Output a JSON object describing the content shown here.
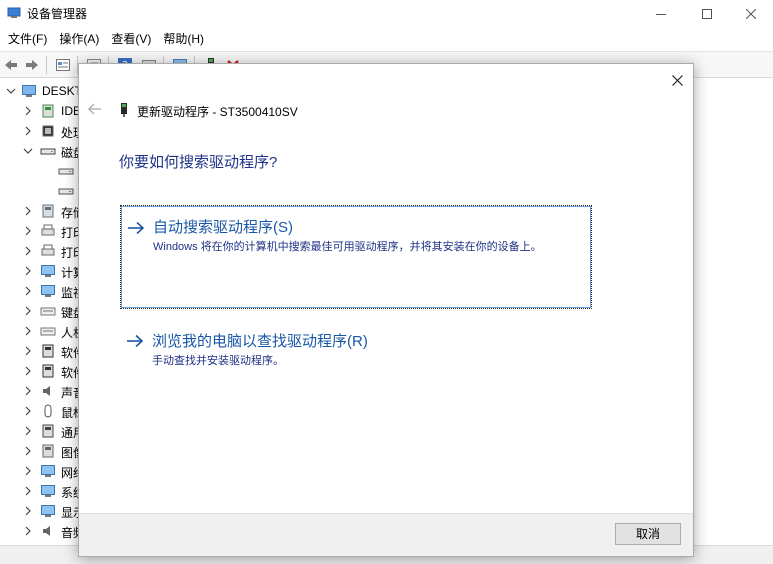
{
  "window": {
    "title": "设备管理器",
    "icon": "device-manager-icon"
  },
  "menu": [
    "文件(F)",
    "操作(A)",
    "查看(V)",
    "帮助(H)"
  ],
  "toolbar": {
    "icons": [
      "back-icon",
      "forward-icon",
      "properties-icon",
      "show-hidden-icon",
      "help-icon",
      "view-icon",
      "monitor-icon",
      "update-driver-icon",
      "uninstall-icon"
    ],
    "uninstall_color": "#d01a1a"
  },
  "tree": {
    "root": "DESKT",
    "items": [
      {
        "label": "IDE",
        "icon": "ide-controller-icon",
        "expanded": false
      },
      {
        "label": "处理",
        "icon": "processor-icon",
        "expanded": false
      },
      {
        "label": "磁盘",
        "icon": "disk-drive-icon",
        "expanded": true
      },
      {
        "label": "",
        "icon": "disk-icon",
        "child": true
      },
      {
        "label": "",
        "icon": "disk-icon",
        "child": true
      },
      {
        "label": "存储",
        "icon": "storage-controller-icon",
        "expanded": false
      },
      {
        "label": "打印",
        "icon": "print-queue-icon",
        "expanded": false
      },
      {
        "label": "打印",
        "icon": "printer-icon",
        "expanded": false
      },
      {
        "label": "计算",
        "icon": "computer-icon",
        "expanded": false
      },
      {
        "label": "监视",
        "icon": "monitor-icon",
        "expanded": false
      },
      {
        "label": "键盘",
        "icon": "keyboard-icon",
        "expanded": false
      },
      {
        "label": "人机",
        "icon": "hid-icon",
        "expanded": false
      },
      {
        "label": "软件",
        "icon": "software-component-icon",
        "expanded": false
      },
      {
        "label": "软件",
        "icon": "software-device-icon",
        "expanded": false
      },
      {
        "label": "声音",
        "icon": "sound-icon",
        "expanded": false
      },
      {
        "label": "鼠标",
        "icon": "mouse-icon",
        "expanded": false
      },
      {
        "label": "通用",
        "icon": "usb-icon",
        "expanded": false
      },
      {
        "label": "图像",
        "icon": "imaging-icon",
        "expanded": false
      },
      {
        "label": "网络",
        "icon": "network-icon",
        "expanded": false
      },
      {
        "label": "系统",
        "icon": "system-devices-icon",
        "expanded": false
      },
      {
        "label": "显示",
        "icon": "display-adapter-icon",
        "expanded": false
      },
      {
        "label": "音频",
        "icon": "audio-icon",
        "expanded": false
      }
    ]
  },
  "dialog": {
    "header_title": "更新驱动程序 - ST3500410SV",
    "question": "你要如何搜索驱动程序?",
    "options": [
      {
        "title": "自动搜索驱动程序(S)",
        "description": "Windows 将在你的计算机中搜索最佳可用驱动程序，并将其安装在你的设备上。"
      },
      {
        "title": "浏览我的电脑以查找驱动程序(R)",
        "description": "手动查找并安装驱动程序。"
      }
    ],
    "cancel_label": "取消",
    "accent_color": "#1a57a6"
  }
}
